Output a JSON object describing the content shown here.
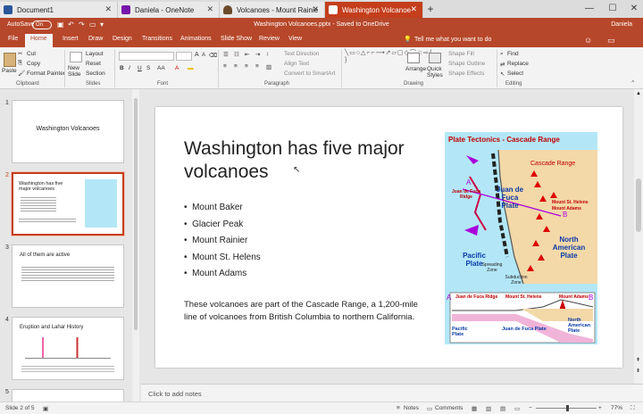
{
  "browser_tabs": [
    {
      "label": "Document1",
      "icon_color": "#2b579a",
      "active": false
    },
    {
      "label": "Daniela - OneNote",
      "icon_color": "#7719aa",
      "active": false
    },
    {
      "label": "Volcanoes - Mount Rainie",
      "icon_color": "#6b4a2b",
      "active": false
    },
    {
      "label": "Washington Volcanoe",
      "icon_color": "#ffffff",
      "active": true
    }
  ],
  "window": {
    "minimize": "—",
    "maximize": "☐",
    "close": "✕",
    "new_tab": "+"
  },
  "titlebar": {
    "autosave_label": "AutoSave",
    "autosave_state": "On",
    "doc_title": "Washington Volcanoes.pptx - Saved to OneDrive",
    "user": "Daniela"
  },
  "ribbon_tabs": [
    "File",
    "Home",
    "Insert",
    "Draw",
    "Design",
    "Transitions",
    "Animations",
    "Slide Show",
    "Review",
    "View"
  ],
  "tell_me": "Tell me what you want to do",
  "ribbon": {
    "clipboard": {
      "paste": "Paste",
      "cut": "Cut",
      "copy": "Copy",
      "format_painter": "Format Painter",
      "label": "Clipboard"
    },
    "slides": {
      "new_slide": "New Slide",
      "layout": "Layout",
      "reset": "Reset",
      "section": "Section",
      "label": "Slides"
    },
    "font": {
      "label": "Font",
      "bold": "B",
      "italic": "I",
      "underline": "U",
      "strike": "S",
      "aa": "AA"
    },
    "paragraph": {
      "text_direction": "Text Direction",
      "align_text": "Align Text",
      "smartart": "Convert to SmartArt",
      "label": "Paragraph"
    },
    "drawing": {
      "arrange": "Arrange",
      "quick_styles": "Quick Styles",
      "shape_fill": "Shape Fill",
      "shape_outline": "Shape Outline",
      "shape_effects": "Shape Effects",
      "label": "Drawing"
    },
    "editing": {
      "find": "Find",
      "replace": "Replace",
      "select": "Select",
      "label": "Editing"
    }
  },
  "thumbnails": [
    {
      "num": "1",
      "title": "Washington Volcanoes"
    },
    {
      "num": "2",
      "title": "Washington has five major volcanoes"
    },
    {
      "num": "3",
      "title": "All of them are active"
    },
    {
      "num": "4",
      "title": "Eruption and Lahar History"
    },
    {
      "num": "5",
      "title": ""
    }
  ],
  "slide": {
    "title": "Washington has five major volcanoes",
    "bullets": [
      "Mount Baker",
      "Glacier Peak",
      "Mount Rainier",
      "Mount St. Helens",
      "Mount Adams"
    ],
    "body": "These volcanoes are part of the Cascade Range, a 1,200-mile line of volcanoes from British Columbia to northern California.",
    "map": {
      "title": "Plate Tectonics - Cascade Range",
      "cascade_range": "Cascade Range",
      "juan_de_fuca_ridge": "Juan de Fuca Ridge",
      "juan_de_fuca_plate": "Juan de Fuca Plate",
      "pacific_plate": "Pacific Plate",
      "north_american_plate": "North American Plate",
      "spreading_zone": "Spreading Zone",
      "subduction_zone": "Subduction Zone",
      "mt_st_helens": "Mount St. Helens",
      "mt_adams": "Mount Adams",
      "label_a": "A",
      "label_b": "B",
      "sec_ridge": "Juan de Fuca Ridge",
      "sec_st_helens": "Mount St. Helens",
      "sec_adams": "Mount Adams",
      "sec_pacific": "Pacific Plate",
      "sec_jdf": "Juan de Fuca Plate",
      "sec_na": "North American Plate"
    }
  },
  "notes_placeholder": "Click to add notes",
  "status": {
    "slide_of": "Slide 2 of 5",
    "notes": "Notes",
    "comments": "Comments",
    "zoom": "77%"
  },
  "colors": {
    "accent": "#b7472a",
    "tab_active": "#c43e1c",
    "map_bg": "#b3e7f7",
    "map_title": "#c00000"
  }
}
